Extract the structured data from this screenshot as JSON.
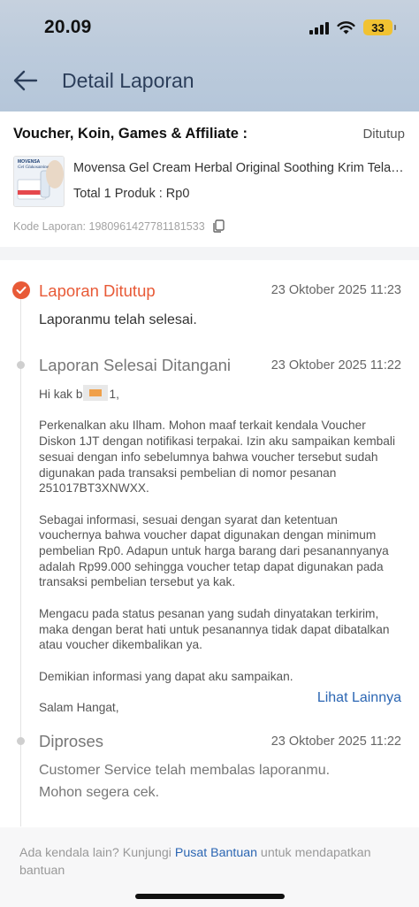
{
  "status_bar": {
    "time": "20.09",
    "battery": "33"
  },
  "header": {
    "title": "Detail Laporan",
    "back_icon": "arrow-left-icon"
  },
  "product_card": {
    "section_title": "Voucher, Koin, Games & Affiliate :",
    "status": "Ditutup",
    "product_name": "Movensa Gel Cream Herbal Original Soothing Krim Telapak Kaki",
    "total": "Total 1 Produk : Rp0",
    "report_code": "Kode Laporan: 1980961427781181533",
    "thumb_label": "MOVENSA",
    "thumb_sub": "Gel Glukosamine"
  },
  "timeline": {
    "accent": "#e85a37",
    "events": [
      {
        "title": "Laporan Ditutup",
        "time": "23 Oktober 2025 11:23",
        "body": "Laporanmu telah selesai."
      },
      {
        "title": "Laporan Selesai Ditangani",
        "time": "23 Oktober 2025 11:22",
        "greeting_prefix": "Hi kak b",
        "greeting_suffix": "1,",
        "paragraphs": [
          "Perkenalkan aku Ilham. Mohon maaf terkait kendala Voucher Diskon 1JT dengan notifikasi terpakai. Izin aku sampaikan kembali sesuai dengan info sebelumnya bahwa voucher tersebut sudah digunakan pada transaksi pembelian di nomor pesanan 251017BT3XNWXX.",
          "Sebagai informasi, sesuai dengan syarat dan ketentuan vouchernya bahwa voucher dapat digunakan dengan minimum pembelian Rp0. Adapun untuk harga barang dari pesanannyanya adalah Rp99.000 sehingga voucher tetap dapat digunakan pada transaksi pembelian tersebut ya kak.",
          "Mengacu pada status pesanan yang sudah dinyatakan terkirim, maka dengan berat hati untuk pesanannya tidak dapat dibatalkan atau voucher dikembalikan ya.",
          "Demikian informasi yang dapat aku sampaikan."
        ],
        "closing": "Salam Hangat,",
        "see_more": "Lihat Lainnya"
      },
      {
        "title": "Diproses",
        "time": "23 Oktober 2025 11:22",
        "body_line1": "Customer Service telah membalas laporanmu.",
        "body_line2": "Mohon segera cek."
      }
    ]
  },
  "footer": {
    "text_before": "Ada kendala lain? Kunjungi ",
    "link": "Pusat Bantuan",
    "text_after": " untuk mendapatkan bantuan"
  }
}
